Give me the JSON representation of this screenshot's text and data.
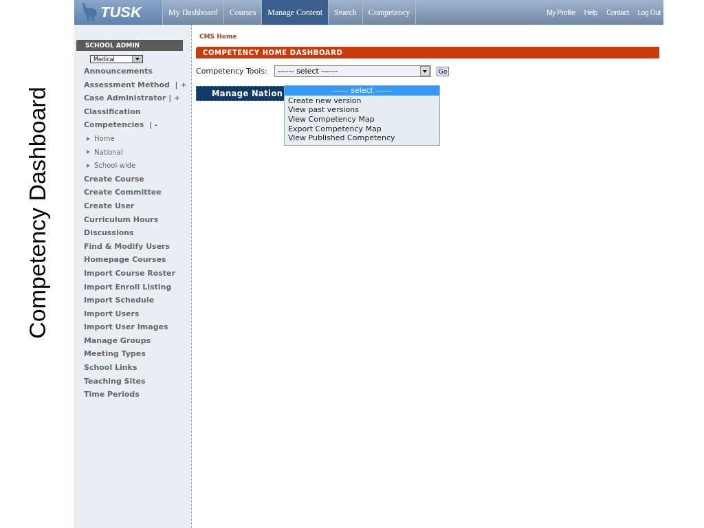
{
  "slide_title": "Competency Dashboard",
  "header": {
    "logo": "TUSK",
    "tabs": [
      {
        "label": "My Dashboard",
        "selected": false
      },
      {
        "label": "Courses",
        "selected": false
      },
      {
        "label": "Manage Content",
        "selected": true
      },
      {
        "label": "Search",
        "selected": false
      },
      {
        "label": "Competency",
        "selected": false
      }
    ],
    "links": [
      "My Profile",
      "Help",
      "Contact",
      "Log Out"
    ]
  },
  "sidebar": {
    "title": "SCHOOL ADMIN",
    "school_select": "Medical",
    "items": [
      {
        "label": "Announcements"
      },
      {
        "label": "Assessment Method  | +"
      },
      {
        "label": "Case Administrator | +"
      },
      {
        "label": "Classification"
      },
      {
        "label": "Competencies  | -",
        "children": [
          {
            "label": "Home"
          },
          {
            "label": "National"
          },
          {
            "label": "School-wide"
          }
        ]
      },
      {
        "label": "Create Course"
      },
      {
        "label": "Create Committee"
      },
      {
        "label": "Create User"
      },
      {
        "label": "Curriculum Hours"
      },
      {
        "label": "Discussions"
      },
      {
        "label": "Find & Modify Users"
      },
      {
        "label": "Homepage Courses"
      },
      {
        "label": "Import Course Roster"
      },
      {
        "label": "Import Enroll Listing"
      },
      {
        "label": "Import Schedule"
      },
      {
        "label": "Import Users"
      },
      {
        "label": "Import User Images"
      },
      {
        "label": "Manage Groups"
      },
      {
        "label": "Meeting Types"
      },
      {
        "label": "School Links"
      },
      {
        "label": "Teaching Sites"
      },
      {
        "label": "Time Periods"
      }
    ]
  },
  "main": {
    "breadcrumb": "CMS Home",
    "section_title": "COMPETENCY HOME DASHBOARD",
    "tools_label": "Competency Tools:",
    "tools_select": "------ select ------",
    "go_button": "Go",
    "dropdown_options": [
      {
        "label": "------ select ------",
        "selected": true
      },
      {
        "label": "Create new version",
        "selected": false
      },
      {
        "label": "View past versions",
        "selected": false
      },
      {
        "label": "View Competency Map",
        "selected": false
      },
      {
        "label": "Export Competency Map",
        "selected": false
      },
      {
        "label": "View Published Competency",
        "selected": false
      }
    ],
    "manage_button": "Manage Nation"
  }
}
